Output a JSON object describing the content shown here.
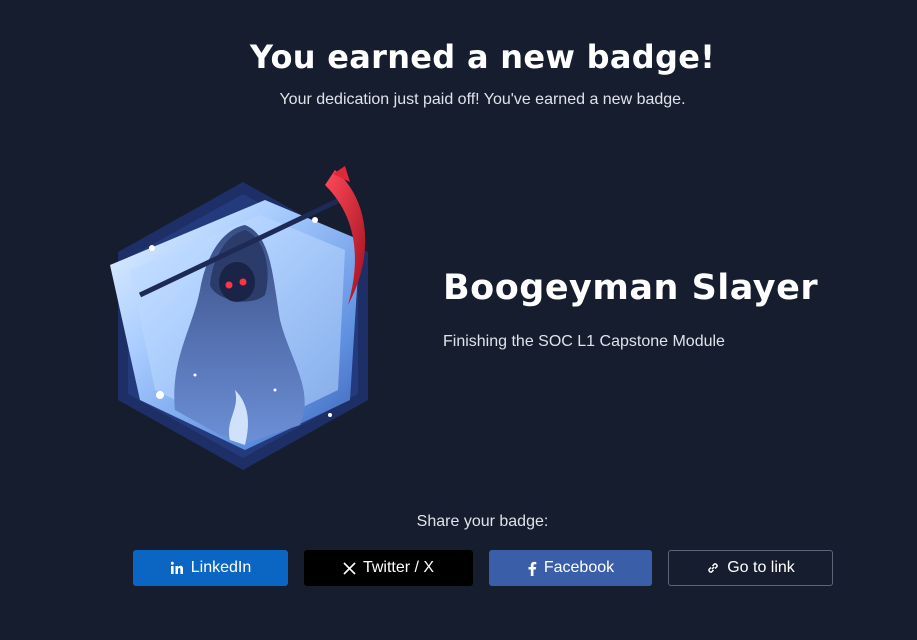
{
  "header": {
    "title": "You earned a new badge!",
    "subtitle": "Your dedication just paid off! You've earned a new badge."
  },
  "badge": {
    "name": "Boogeyman Slayer",
    "description": "Finishing the SOC L1 Capstone Module",
    "image_icon": "grim-reaper-hexagon-badge"
  },
  "share": {
    "label": "Share your badge:",
    "buttons": [
      {
        "label": "LinkedIn",
        "icon": "linkedin-icon",
        "color": "#0a66c2"
      },
      {
        "label": "Twitter / X",
        "icon": "x-icon",
        "color": "#000000"
      },
      {
        "label": "Facebook",
        "icon": "facebook-icon",
        "color": "#3b5ea8"
      },
      {
        "label": "Go to link",
        "icon": "link-icon",
        "color": "#161d2e"
      }
    ]
  },
  "colors": {
    "background": "#161d2e",
    "accent_red": "#e0283a",
    "badge_blue": "#7fb6ff"
  }
}
